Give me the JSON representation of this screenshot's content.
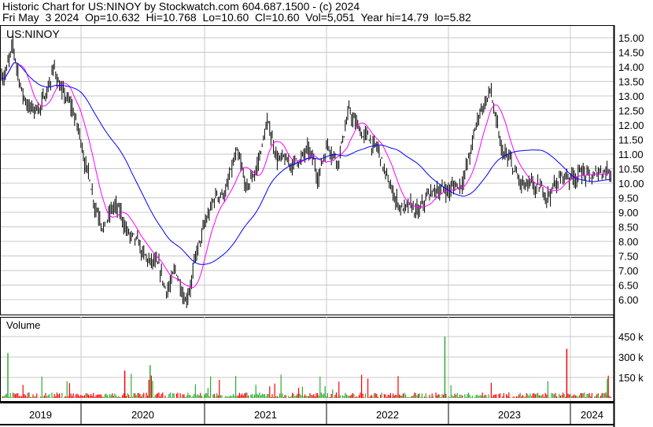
{
  "header": {
    "line1": "Historic Chart for US:NINOY by Stockwatch.com 604.687.1500 - (c) 2024",
    "line2": "Fri May  3 2024  Op=10.632  Hi=10.768  Lo=10.60  Cl=10.60  Vol=5,051  Year hi=14.79  lo=5.82"
  },
  "chart_data": {
    "type": "line",
    "title": "US:NINOY",
    "volume_label": "Volume",
    "price_ticks": [
      "15.00",
      "14.50",
      "14.00",
      "13.50",
      "13.00",
      "12.50",
      "12.00",
      "11.50",
      "11.00",
      "10.50",
      "10.00",
      "9.50",
      "9.00",
      "8.50",
      "8.00",
      "7.50",
      "7.00",
      "6.50",
      "6.00"
    ],
    "ylim": [
      5.6,
      15.4
    ],
    "volume_ticks": [
      "450 k",
      "300 k",
      "150 k"
    ],
    "volume_tick_values": [
      450000,
      300000,
      150000
    ],
    "years": [
      "2019",
      "2020",
      "2021",
      "2022",
      "2023",
      "2024"
    ],
    "x_start": "2019-05",
    "x_end": "2024-05",
    "monthly_close": [
      13.8,
      14.5,
      13.0,
      12.5,
      12.8,
      14.0,
      13.0,
      12.3,
      11.0,
      9.5,
      8.8,
      9.2,
      8.5,
      7.8,
      7.2,
      7.0,
      6.2,
      6.8,
      6.2,
      7.5,
      8.5,
      9.5,
      9.8,
      10.8,
      9.5,
      10.5,
      12.0,
      11.0,
      10.5,
      10.8,
      11.0,
      10.2,
      11.5,
      11.0,
      12.5,
      11.8,
      11.5,
      11.0,
      9.8,
      9.3,
      9.0,
      8.8,
      9.5,
      9.8,
      9.8,
      10.0,
      11.0,
      12.5,
      13.2,
      11.0,
      10.5,
      9.8,
      9.6,
      9.5,
      9.8,
      10.2,
      10.3,
      10.5,
      10.0,
      10.5,
      10.6
    ],
    "volume_spikes": [
      {
        "month": 0.5,
        "value": 330000,
        "dir": "up"
      },
      {
        "month": 12,
        "value": 200000,
        "dir": "down"
      },
      {
        "month": 14.5,
        "value": 240000,
        "dir": "up"
      },
      {
        "month": 43.5,
        "value": 450000,
        "dir": "up"
      },
      {
        "month": 55.5,
        "value": 360000,
        "dir": "down"
      },
      {
        "month": 59.5,
        "value": 140000,
        "dir": "up"
      }
    ],
    "series": [
      {
        "name": "Price OHLC",
        "color": "#000000"
      },
      {
        "name": "Short MA",
        "color": "#ff00ff"
      },
      {
        "name": "Long MA",
        "color": "#0000ff"
      }
    ],
    "colors": {
      "up": "#33aa33",
      "down": "#ff0000",
      "grid": "#c8c8c8"
    }
  }
}
